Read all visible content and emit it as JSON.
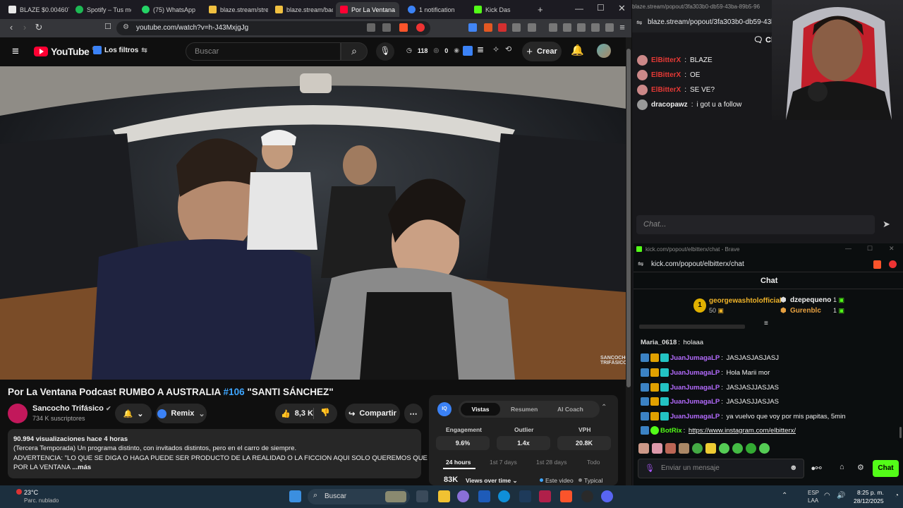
{
  "tabs": [
    {
      "label": "BLAZE $0.004607",
      "color": "#e8e8e8"
    },
    {
      "label": "Spotify – Tus me",
      "color": "#1db954"
    },
    {
      "label": "(75) WhatsApp",
      "color": "#25d366"
    },
    {
      "label": "blaze.stream/stre",
      "color": "#f0c040"
    },
    {
      "label": "blaze.stream/bac",
      "color": "#f0c040"
    },
    {
      "label": "Por La Ventana",
      "color": "#ff0033"
    },
    {
      "label": "1 notification",
      "color": "#3b82f6"
    },
    {
      "label": "Kick Das",
      "color": "#53fc18"
    }
  ],
  "address": {
    "url": "youtube.com/watch?v=h-J43MxjgJg"
  },
  "youtube": {
    "logo": "YouTube",
    "logo_sup": "CO",
    "filters": "Los filtros",
    "search_placeholder": "Buscar",
    "stats": {
      "views": "118",
      "eyes": "0",
      "watching": "1"
    },
    "create_label": "Crear",
    "video_watermark": "SANCOCHO TRIFÁSICO",
    "title_pre": "Por La Ventana Podcast RUMBO A AUSTRALIA ",
    "title_tag": "#106",
    "title_post": " \"SANTI SÁNCHEZ\"",
    "channel_name": "Sancocho Trifásico",
    "channel_subs": "734 K suscriptores",
    "remix_label": "Remix",
    "likes": "8,3 K",
    "share_label": "Compartir",
    "desc_meta": "90.994 visualizaciones  hace 4 horas",
    "desc_line1": "(Tercera Temporada) Un programa distinto, con invitados distintos, pero en el carro de siempre.",
    "desc_line2": "ADVERTENCIA: \"LO QUE SE DIGA O HAGA PUEDE SER PRODUCTO DE LA REALIDAD O LA FICCION AQUI SOLO QUEREMOS QUE ENTREN",
    "desc_line3": "POR LA VENTANA",
    "desc_more": "...más"
  },
  "iq": {
    "logo": "IQ",
    "tabs": [
      "Vistas",
      "Resumen",
      "AI Coach"
    ],
    "metrics": [
      {
        "label": "Engagement",
        "value": "9.6%"
      },
      {
        "label": "Outlier",
        "value": "1.4x"
      },
      {
        "label": "VPH",
        "value": "20.8K"
      }
    ],
    "periods": [
      "24 hours",
      "1st 7 days",
      "1st 28 days",
      "Todo"
    ],
    "views_value": "83K",
    "views_mode": "Views over time",
    "legend_this": "Este video",
    "legend_typical": "Typical"
  },
  "blaze": {
    "tab_url": "blaze.stream/popout/3fa303b0-db59-43ba-89b5-96",
    "url": "blaze.stream/popout/3fa303b0-db59-43ba",
    "chat_label": "Chat",
    "messages": [
      {
        "user": "ElBitterX",
        "text": "BLAZE"
      },
      {
        "user": "ElBitterX",
        "text": "OE"
      },
      {
        "user": "ElBitterX",
        "text": "SE VE?"
      },
      {
        "user": "dracopawz",
        "text": "i got u a follow"
      }
    ],
    "input_placeholder": "Chat..."
  },
  "kick": {
    "window_title": "kick.com/popout/elbitterx/chat - Brave",
    "url": "kick.com/popout/elbitterx/chat",
    "header": "Chat",
    "top_gifter": {
      "name": "georgewashtolofficial",
      "count": "50",
      "rank": "1"
    },
    "leaders": [
      {
        "name": "dzepequeno",
        "count": "1"
      },
      {
        "name": "Gurenblc",
        "count": "1"
      }
    ],
    "messages": [
      {
        "user": "Maria_0618",
        "text": "holaaa",
        "color": "#ffffff"
      },
      {
        "user": "JuanJumagaLP",
        "text": "JASJASJASJASJ",
        "color": "#b46bff"
      },
      {
        "user": "JuanJumagaLP",
        "text": "Hola Marii mor",
        "color": "#b46bff"
      },
      {
        "user": "JuanJumagaLP",
        "text": "JASJASJJASJAS",
        "color": "#b46bff"
      },
      {
        "user": "JuanJumagaLP",
        "text": "JASJASJJASJAS",
        "color": "#b46bff"
      },
      {
        "user": "JuanJumagaLP",
        "text": "ya vuelvo que voy por mis papitas, 5min",
        "color": "#b46bff"
      },
      {
        "user": "BotRix",
        "text": "https://www.instagram.com/elbitterx/",
        "color": "#53fc18"
      }
    ],
    "input_placeholder": "Enviar un mensaje",
    "chat_button": "Chat"
  },
  "taskbar": {
    "weather_temp": "23°C",
    "weather_desc": "Parc. nublado",
    "search_label": "Buscar",
    "lang_top": "ESP",
    "lang_bottom": "LAA",
    "time": "8:25 p. m.",
    "date": "28/12/2025"
  }
}
